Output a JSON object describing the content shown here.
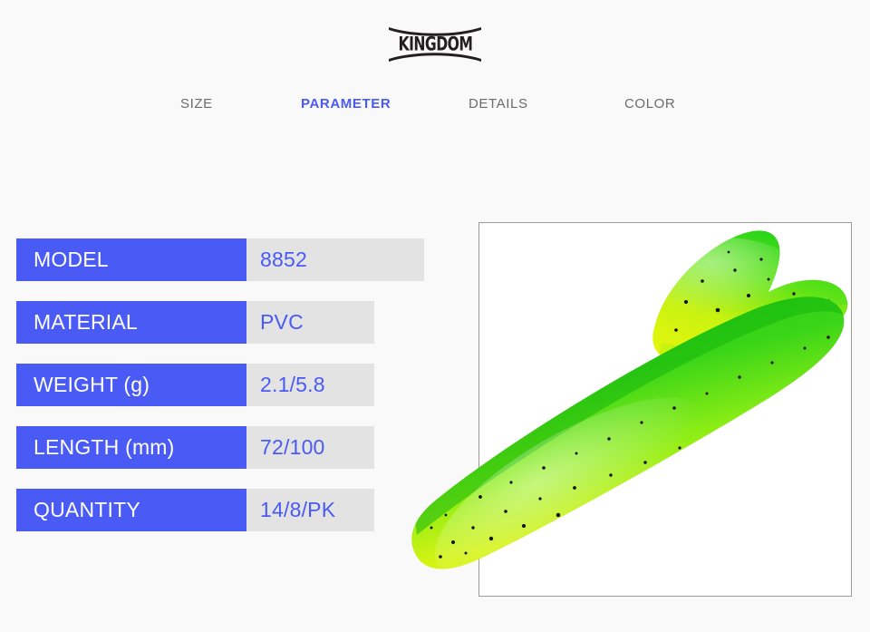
{
  "brand": {
    "logo_text": "KINGDOM",
    "logo_icon": "kingdom-bowtie-logo"
  },
  "nav": {
    "tabs": [
      {
        "label": "SIZE",
        "active": false
      },
      {
        "label": "PARAMETER",
        "active": true
      },
      {
        "label": "DETAILS",
        "active": false
      },
      {
        "label": "COLOR",
        "active": false
      }
    ],
    "active_color": "#4a5af5",
    "inactive_color": "#6b6b6b"
  },
  "spec_table": {
    "label_bg": "#4a5af5",
    "label_color": "#ffffff",
    "value_bg": "#e3e3e3",
    "value_color": "#4a5af5",
    "rows": [
      {
        "label": "MODEL",
        "value": "8852"
      },
      {
        "label": "MATERIAL",
        "value": "PVC"
      },
      {
        "label": "WEIGHT (g)",
        "value": "2.1/5.8"
      },
      {
        "label": "LENGTH (mm)",
        "value": "72/100"
      },
      {
        "label": "QUANTITY",
        "value": "14/8/PK"
      }
    ]
  },
  "product_image": {
    "alt": "green-yellow-soft-plastic-swimbait-lure",
    "body_color_top": "#2ecc1e",
    "body_color_bottom": "#d9f216",
    "fleck_color": "#111111",
    "frame_border": "#9b9b9b",
    "frame_bg": "#ffffff"
  },
  "page": {
    "background": "#f9f9f9"
  }
}
